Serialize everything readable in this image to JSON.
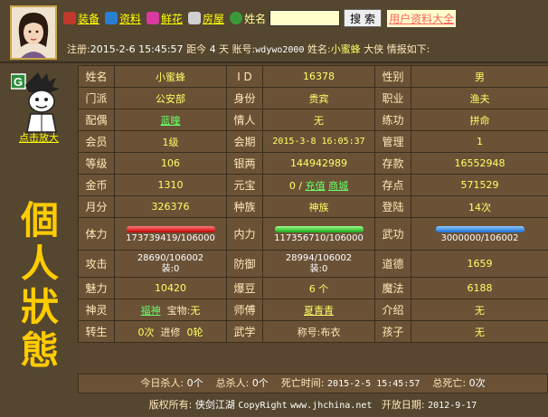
{
  "nav": {
    "items": [
      {
        "label": "装备",
        "icon": "equipment-icon",
        "color": "#c0392b"
      },
      {
        "label": "资料",
        "icon": "profile-icon",
        "color": "#2a7fd0"
      },
      {
        "label": "鲜花",
        "icon": "flower-icon",
        "color": "#d83aa0"
      },
      {
        "label": "房屋",
        "icon": "house-icon",
        "color": "#d0d0d0"
      }
    ],
    "search_label": "姓名",
    "search_value": "",
    "search_button": "搜 索",
    "all_users_link": "用户资料大全"
  },
  "info": {
    "reg_label": "注册:",
    "reg_time": "2015-2-6 15:45:57",
    "days_label": "距今",
    "days": "4",
    "days_unit": "天",
    "account_label": "账号:",
    "account": "wdywo2000",
    "name_label": "姓名:",
    "name": "小蜜蜂",
    "title": "大侠",
    "suffix": "情报如下:"
  },
  "left": {
    "enlarge_link": "点击放大",
    "title_chars": [
      "個",
      "人",
      "狀",
      "態"
    ]
  },
  "grid": {
    "row1": {
      "k1": "姓名",
      "v1": "小蜜蜂",
      "k2": "I D",
      "v2": "16378",
      "k3": "性别",
      "v3": "男"
    },
    "row2": {
      "k1": "门派",
      "v1": "公安部",
      "k2": "身份",
      "v2": "贵宾",
      "k3": "职业",
      "v3": "渔夫"
    },
    "row3": {
      "k1": "配偶",
      "v1": "蓝瞳",
      "k2": "情人",
      "v2": "无",
      "k3": "练功",
      "v3": "拼命"
    },
    "row4": {
      "k1": "会员",
      "v1": "1级",
      "k2": "会期",
      "v2": "2015-3-8 16:05:37",
      "k3": "管理",
      "v3": "1"
    },
    "row5": {
      "k1": "等级",
      "v1": "106",
      "k2": "银两",
      "v2": "144942989",
      "k3": "存款",
      "v3": "16552948"
    },
    "row6": {
      "k1": "金币",
      "v1": "1310",
      "k2": "元宝",
      "v2_prefix": "0 /",
      "v2_link1": "充值",
      "v2_link2": "商城",
      "k3": "存点",
      "v3": "571529"
    },
    "row7": {
      "k1": "月分",
      "v1": "326376",
      "k2": "种族",
      "v2": "神族",
      "k3": "登陆",
      "v3": "14次"
    },
    "row8": {
      "k1": "体力",
      "v1": "173739419/106000",
      "k2": "内力",
      "v2": "117356710/106000",
      "k3": "武功",
      "v3": "3000000/106002"
    },
    "row9": {
      "k1": "攻击",
      "v1a": "28690/106002",
      "v1b": "装:0",
      "k2": "防御",
      "v2a": "28994/106002",
      "v2b": "装:0",
      "k3": "道德",
      "v3": "1659"
    },
    "row10": {
      "k1": "魅力",
      "v1": "10420",
      "k2": "爆豆",
      "v2": "6 个",
      "k3": "魔法",
      "v3": "6188"
    },
    "row11": {
      "k1": "神灵",
      "v1a": "福神",
      "v1b_label": "宝物:",
      "v1b": "无",
      "k2": "师傅",
      "v2": "夏青青",
      "k3": "介绍",
      "v3": "无"
    },
    "row12": {
      "k1": "转生",
      "v1a": "0次",
      "v1b_label": "进修",
      "v1b": "0轮",
      "k2": "武学",
      "v2_label": "称号:",
      "v2": "布衣",
      "k3": "孩子",
      "v3": "无"
    }
  },
  "footer": {
    "today_kill_label": "今日杀人:",
    "today_kill": "0个",
    "total_kill_label": "总杀人:",
    "total_kill": "0个",
    "death_time_label": "死亡时间:",
    "death_time": "2015-2-5 15:45:57",
    "total_death_label": "总死亡:",
    "total_death": "0次",
    "copyright_label": "版权所有:",
    "site_name": "侠剑江湖",
    "copyright_text": "CopyRight",
    "site_url": "www.jhchina.net",
    "opened_label": "开放日期:",
    "opened_date": "2012-9-17"
  }
}
